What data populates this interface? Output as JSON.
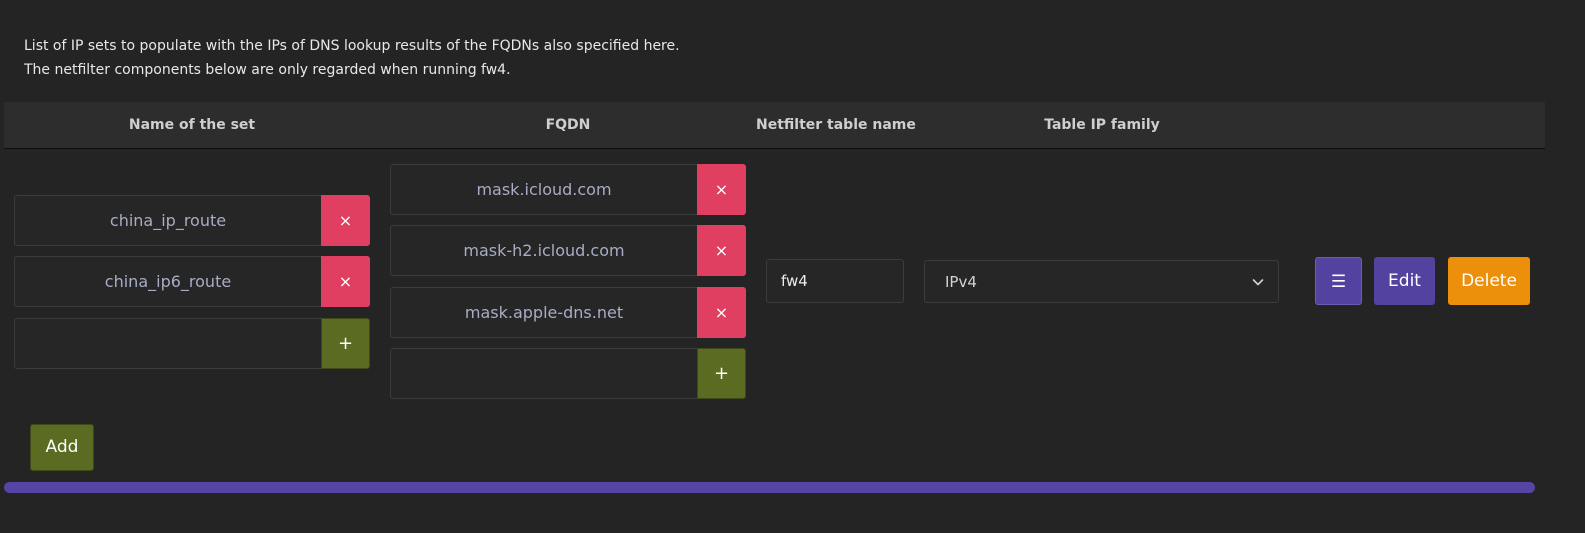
{
  "description": {
    "line1": "List of IP sets to populate with the IPs of DNS lookup results of the FQDNs also specified here.",
    "line2": "The netfilter components below are only regarded when running fw4."
  },
  "table": {
    "headers": {
      "name": "Name of the set",
      "fqdn": "FQDN",
      "netfilter_table": "Netfilter table name",
      "ip_family": "Table IP family"
    }
  },
  "row": {
    "set_names": [
      "china_ip_route",
      "china_ip6_route"
    ],
    "set_names_new_placeholder": "",
    "fqdns": [
      "mask.icloud.com",
      "mask-h2.icloud.com",
      "mask.apple-dns.net"
    ],
    "fqdns_new_placeholder": "",
    "netfilter_table": "fw4",
    "ip_family_selected": "IPv4",
    "remove_glyph": "×",
    "add_glyph": "+",
    "menu_glyph": "☰",
    "edit_label": "Edit",
    "delete_label": "Delete"
  },
  "footer": {
    "add_label": "Add"
  },
  "colors": {
    "remove": "#e03f62",
    "add": "#5b6b22",
    "primary": "#5342a0",
    "delete": "#ec8f0a"
  }
}
